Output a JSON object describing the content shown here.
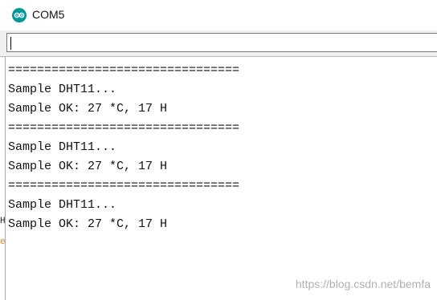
{
  "window": {
    "title": "COM5",
    "icon": "arduino-infinity-icon",
    "accent_color": "#00979c"
  },
  "send_field": {
    "value": ""
  },
  "output": {
    "lines": [
      "================================",
      "Sample DHT11...",
      "Sample OK: 27 *C, 17 H",
      "================================",
      "Sample DHT11...",
      "Sample OK: 27 *C, 17 H",
      "================================",
      "Sample DHT11...",
      "Sample OK: 27 *C, 17 H"
    ]
  },
  "edge_fragments": {
    "upper": "H",
    "lower": "e",
    "lower_color": "#d98a2b"
  },
  "watermark": "https://blog.csdn.net/bemfa"
}
